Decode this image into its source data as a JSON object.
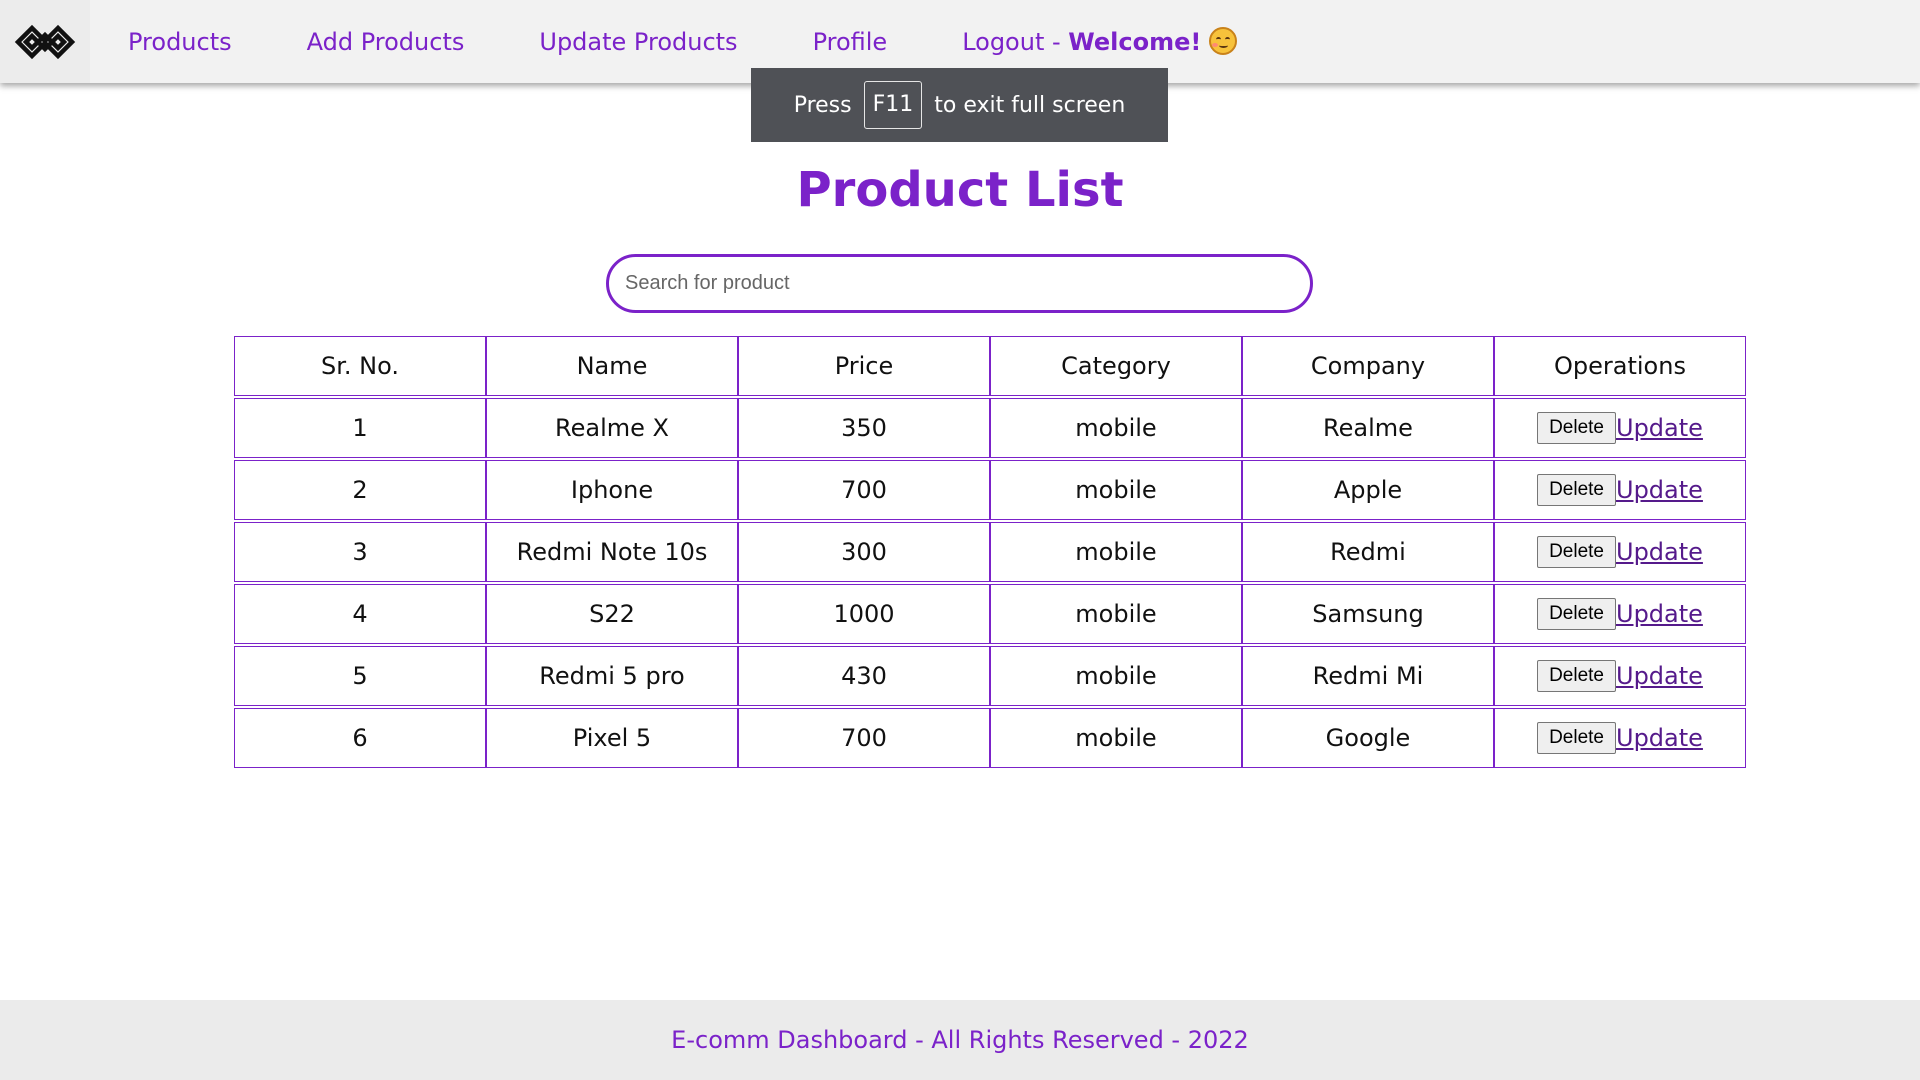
{
  "nav": {
    "logo_icon": "infinity-diamond-logo-icon",
    "links": [
      "Products",
      "Add Products",
      "Update Products",
      "Profile"
    ],
    "logout_label": "Logout - ",
    "welcome_label": "Welcome!",
    "emoji_icon": "smiling-face-with-hearts-emoji-icon"
  },
  "toast": {
    "prefix": "Press",
    "key": "F11",
    "suffix": "to exit full screen"
  },
  "main": {
    "title": "Product List",
    "search": {
      "placeholder": "Search for product",
      "value": ""
    }
  },
  "table": {
    "headers": [
      "Sr. No.",
      "Name",
      "Price",
      "Category",
      "Company",
      "Operations"
    ],
    "rows": [
      [
        "1",
        "Realme X",
        "350",
        "mobile",
        "Realme"
      ],
      [
        "2",
        "Iphone",
        "700",
        "mobile",
        "Apple"
      ],
      [
        "3",
        "Redmi Note 10s",
        "300",
        "mobile",
        "Redmi"
      ],
      [
        "4",
        "S22",
        "1000",
        "mobile",
        "Samsung"
      ],
      [
        "5",
        "Redmi 5 pro",
        "430",
        "mobile",
        "Redmi Mi"
      ],
      [
        "6",
        "Pixel 5",
        "700",
        "mobile",
        "Google"
      ]
    ],
    "delete_label": "Delete",
    "update_label": "Update"
  },
  "footer": {
    "text": "E-comm Dashboard - All Rights Reserved - 2022"
  },
  "colors": {
    "accent": "#7b22c9",
    "toast_bg": "#4f5156",
    "nav_bg": "#f2f2f2",
    "footer_bg": "#ebebeb"
  }
}
